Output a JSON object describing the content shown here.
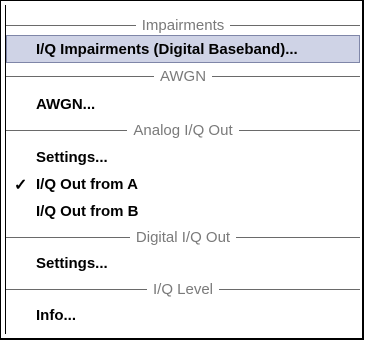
{
  "menu": {
    "sections": [
      {
        "header": "Impairments",
        "items": [
          {
            "label": "I/Q Impairments (Digital Baseband)...",
            "selected": true,
            "checked": false
          }
        ]
      },
      {
        "header": "AWGN",
        "items": [
          {
            "label": "AWGN...",
            "selected": false,
            "checked": false
          }
        ]
      },
      {
        "header": "Analog I/Q Out",
        "items": [
          {
            "label": "Settings...",
            "selected": false,
            "checked": false
          },
          {
            "label": "I/Q Out from A",
            "selected": false,
            "checked": true
          },
          {
            "label": "I/Q Out from B",
            "selected": false,
            "checked": false
          }
        ]
      },
      {
        "header": "Digital I/Q Out",
        "items": [
          {
            "label": "Settings...",
            "selected": false,
            "checked": false
          }
        ]
      },
      {
        "header": "I/Q Level",
        "items": [
          {
            "label": "Info...",
            "selected": false,
            "checked": false
          }
        ]
      }
    ],
    "check_glyph": "✓",
    "colors": {
      "selected_bg": "#cfd3e6",
      "header_text": "#7a7a7a"
    }
  }
}
